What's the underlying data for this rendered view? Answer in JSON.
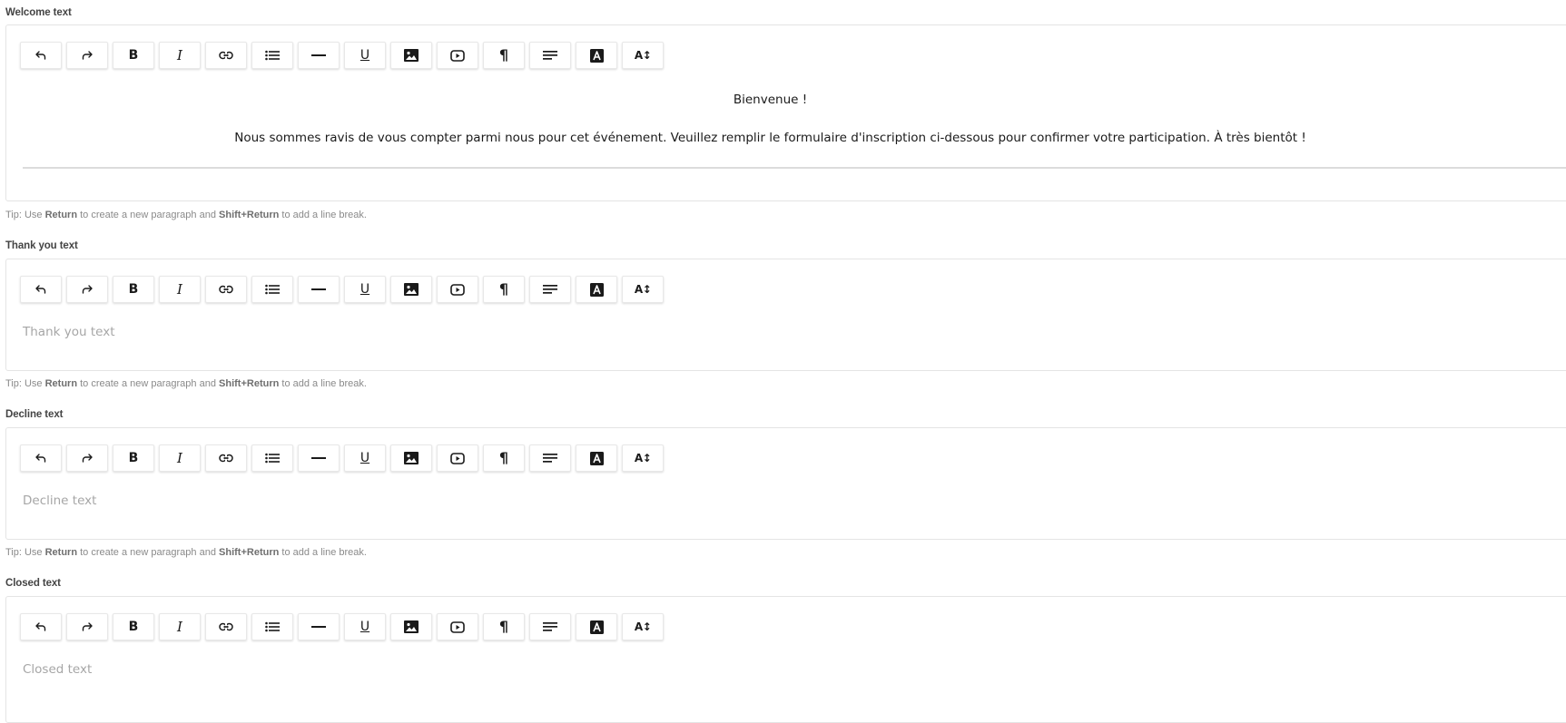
{
  "toolbar": [
    {
      "name": "undo-icon",
      "title": "Undo"
    },
    {
      "name": "redo-icon",
      "title": "Redo"
    },
    {
      "name": "bold-icon",
      "title": "Bold",
      "glyph": "B"
    },
    {
      "name": "italic-icon",
      "title": "Italic",
      "glyph": "I"
    },
    {
      "name": "link-icon",
      "title": "Link"
    },
    {
      "name": "bullet-list-icon",
      "title": "Bullet list"
    },
    {
      "name": "horizontal-rule-icon",
      "title": "Horizontal rule"
    },
    {
      "name": "underline-icon",
      "title": "Underline",
      "glyph": "U"
    },
    {
      "name": "image-icon",
      "title": "Image"
    },
    {
      "name": "video-icon",
      "title": "Video"
    },
    {
      "name": "paragraph-icon",
      "title": "Paragraph",
      "glyph": "¶"
    },
    {
      "name": "align-icon",
      "title": "Align"
    },
    {
      "name": "text-color-icon",
      "title": "Text color",
      "glyph": "A"
    },
    {
      "name": "font-size-icon",
      "title": "Font size",
      "glyph": "A↕"
    }
  ],
  "editors": {
    "welcome": {
      "label": "Welcome text",
      "line1": "Bienvenue !",
      "line2": "Nous sommes ravis de vous compter parmi nous pour cet événement. Veuillez remplir le formulaire d'inscription ci-dessous pour confirmer votre participation. À très bientôt !"
    },
    "thankyou": {
      "label": "Thank you text",
      "placeholder": "Thank you text"
    },
    "decline": {
      "label": "Decline text",
      "placeholder": "Decline text"
    },
    "closed": {
      "label": "Closed text",
      "placeholder": "Closed text"
    }
  },
  "tip": {
    "prefix": "Tip: Use ",
    "key1": "Return",
    "middle": " to create a new paragraph and ",
    "key2": "Shift+Return",
    "suffix": " to add a line break."
  },
  "colors": {
    "border": "#e4e4e4",
    "placeholder": "#a6a6a6",
    "tip": "#8a8a8a"
  }
}
